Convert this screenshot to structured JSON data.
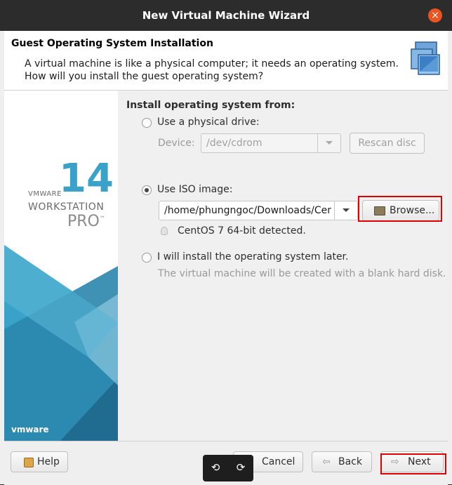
{
  "window": {
    "title": "New Virtual Machine Wizard",
    "close_glyph": "×"
  },
  "header": {
    "title": "Guest Operating System Installation",
    "desc_line1": "A virtual machine is like a physical computer; it needs an operating system.",
    "desc_line2": "How will you install the guest operating system?",
    "icon": "virtual-machines-icon"
  },
  "brand": {
    "vmware_small": "VMWARE",
    "version": "14",
    "product": "WORKSTATION",
    "edition": "PRO",
    "tm": "™",
    "footer_logo": "vmware",
    "accent": "#3aa2c8"
  },
  "install": {
    "section_title": "Install operating system from:",
    "physical": {
      "label": "Use a physical drive:",
      "device_label": "Device:",
      "device_value": "/dev/cdrom",
      "rescan": "Rescan disc",
      "selected": false
    },
    "iso": {
      "label": "Use ISO image:",
      "path": "/home/phungngoc/Downloads/Cen",
      "browse": "Browse...",
      "detected": "CentOS 7 64-bit detected.",
      "selected": true
    },
    "later": {
      "label": "I will install the operating system later.",
      "note": "The virtual machine will be created with a blank hard disk.",
      "selected": false
    }
  },
  "footer": {
    "help": "Help",
    "cancel": "Cancel",
    "back": "Back",
    "next": "Next"
  },
  "colors": {
    "highlight": "#e00000",
    "titlebar": "#2c2c2c",
    "close": "#e95420"
  }
}
